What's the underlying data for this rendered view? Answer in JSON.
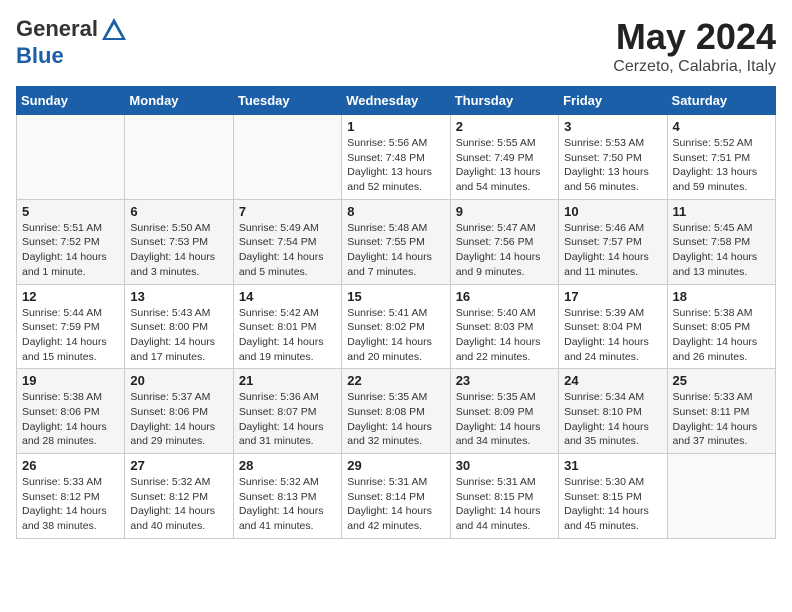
{
  "header": {
    "logo_line1": "General",
    "logo_line2": "Blue",
    "month": "May 2024",
    "location": "Cerzeto, Calabria, Italy"
  },
  "weekdays": [
    "Sunday",
    "Monday",
    "Tuesday",
    "Wednesday",
    "Thursday",
    "Friday",
    "Saturday"
  ],
  "weeks": [
    [
      {
        "day": "",
        "detail": ""
      },
      {
        "day": "",
        "detail": ""
      },
      {
        "day": "",
        "detail": ""
      },
      {
        "day": "1",
        "detail": "Sunrise: 5:56 AM\nSunset: 7:48 PM\nDaylight: 13 hours\nand 52 minutes."
      },
      {
        "day": "2",
        "detail": "Sunrise: 5:55 AM\nSunset: 7:49 PM\nDaylight: 13 hours\nand 54 minutes."
      },
      {
        "day": "3",
        "detail": "Sunrise: 5:53 AM\nSunset: 7:50 PM\nDaylight: 13 hours\nand 56 minutes."
      },
      {
        "day": "4",
        "detail": "Sunrise: 5:52 AM\nSunset: 7:51 PM\nDaylight: 13 hours\nand 59 minutes."
      }
    ],
    [
      {
        "day": "5",
        "detail": "Sunrise: 5:51 AM\nSunset: 7:52 PM\nDaylight: 14 hours\nand 1 minute."
      },
      {
        "day": "6",
        "detail": "Sunrise: 5:50 AM\nSunset: 7:53 PM\nDaylight: 14 hours\nand 3 minutes."
      },
      {
        "day": "7",
        "detail": "Sunrise: 5:49 AM\nSunset: 7:54 PM\nDaylight: 14 hours\nand 5 minutes."
      },
      {
        "day": "8",
        "detail": "Sunrise: 5:48 AM\nSunset: 7:55 PM\nDaylight: 14 hours\nand 7 minutes."
      },
      {
        "day": "9",
        "detail": "Sunrise: 5:47 AM\nSunset: 7:56 PM\nDaylight: 14 hours\nand 9 minutes."
      },
      {
        "day": "10",
        "detail": "Sunrise: 5:46 AM\nSunset: 7:57 PM\nDaylight: 14 hours\nand 11 minutes."
      },
      {
        "day": "11",
        "detail": "Sunrise: 5:45 AM\nSunset: 7:58 PM\nDaylight: 14 hours\nand 13 minutes."
      }
    ],
    [
      {
        "day": "12",
        "detail": "Sunrise: 5:44 AM\nSunset: 7:59 PM\nDaylight: 14 hours\nand 15 minutes."
      },
      {
        "day": "13",
        "detail": "Sunrise: 5:43 AM\nSunset: 8:00 PM\nDaylight: 14 hours\nand 17 minutes."
      },
      {
        "day": "14",
        "detail": "Sunrise: 5:42 AM\nSunset: 8:01 PM\nDaylight: 14 hours\nand 19 minutes."
      },
      {
        "day": "15",
        "detail": "Sunrise: 5:41 AM\nSunset: 8:02 PM\nDaylight: 14 hours\nand 20 minutes."
      },
      {
        "day": "16",
        "detail": "Sunrise: 5:40 AM\nSunset: 8:03 PM\nDaylight: 14 hours\nand 22 minutes."
      },
      {
        "day": "17",
        "detail": "Sunrise: 5:39 AM\nSunset: 8:04 PM\nDaylight: 14 hours\nand 24 minutes."
      },
      {
        "day": "18",
        "detail": "Sunrise: 5:38 AM\nSunset: 8:05 PM\nDaylight: 14 hours\nand 26 minutes."
      }
    ],
    [
      {
        "day": "19",
        "detail": "Sunrise: 5:38 AM\nSunset: 8:06 PM\nDaylight: 14 hours\nand 28 minutes."
      },
      {
        "day": "20",
        "detail": "Sunrise: 5:37 AM\nSunset: 8:06 PM\nDaylight: 14 hours\nand 29 minutes."
      },
      {
        "day": "21",
        "detail": "Sunrise: 5:36 AM\nSunset: 8:07 PM\nDaylight: 14 hours\nand 31 minutes."
      },
      {
        "day": "22",
        "detail": "Sunrise: 5:35 AM\nSunset: 8:08 PM\nDaylight: 14 hours\nand 32 minutes."
      },
      {
        "day": "23",
        "detail": "Sunrise: 5:35 AM\nSunset: 8:09 PM\nDaylight: 14 hours\nand 34 minutes."
      },
      {
        "day": "24",
        "detail": "Sunrise: 5:34 AM\nSunset: 8:10 PM\nDaylight: 14 hours\nand 35 minutes."
      },
      {
        "day": "25",
        "detail": "Sunrise: 5:33 AM\nSunset: 8:11 PM\nDaylight: 14 hours\nand 37 minutes."
      }
    ],
    [
      {
        "day": "26",
        "detail": "Sunrise: 5:33 AM\nSunset: 8:12 PM\nDaylight: 14 hours\nand 38 minutes."
      },
      {
        "day": "27",
        "detail": "Sunrise: 5:32 AM\nSunset: 8:12 PM\nDaylight: 14 hours\nand 40 minutes."
      },
      {
        "day": "28",
        "detail": "Sunrise: 5:32 AM\nSunset: 8:13 PM\nDaylight: 14 hours\nand 41 minutes."
      },
      {
        "day": "29",
        "detail": "Sunrise: 5:31 AM\nSunset: 8:14 PM\nDaylight: 14 hours\nand 42 minutes."
      },
      {
        "day": "30",
        "detail": "Sunrise: 5:31 AM\nSunset: 8:15 PM\nDaylight: 14 hours\nand 44 minutes."
      },
      {
        "day": "31",
        "detail": "Sunrise: 5:30 AM\nSunset: 8:15 PM\nDaylight: 14 hours\nand 45 minutes."
      },
      {
        "day": "",
        "detail": ""
      }
    ]
  ]
}
